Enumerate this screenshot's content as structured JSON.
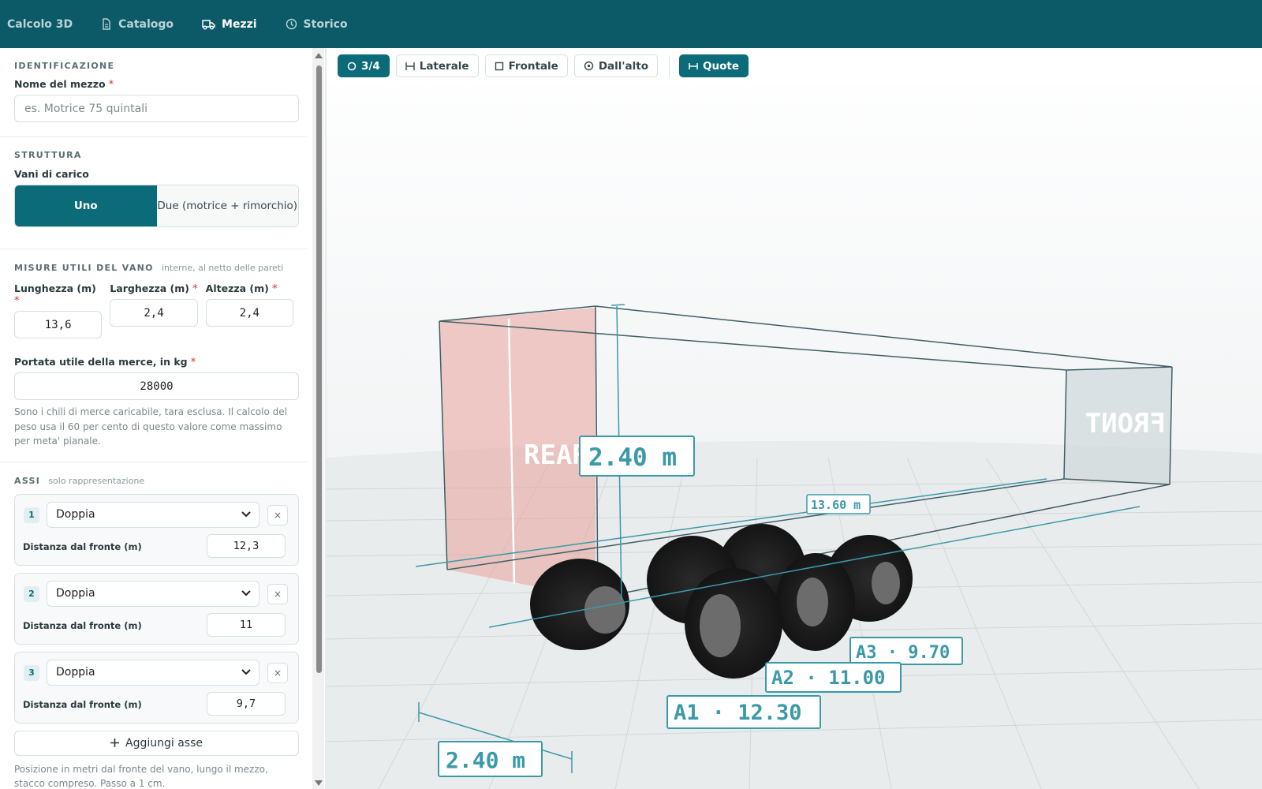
{
  "nav": {
    "items": [
      {
        "label": "Calcolo 3D",
        "icon": "none",
        "active": false
      },
      {
        "label": "Catalogo",
        "icon": "document-icon",
        "active": false
      },
      {
        "label": "Mezzi",
        "icon": "truck-icon",
        "active": true
      },
      {
        "label": "Storico",
        "icon": "clock-icon",
        "active": false
      }
    ]
  },
  "identificazione": {
    "title": "IDENTIFICAZIONE",
    "name_label": "Nome del mezzo",
    "required_mark": "*",
    "name_placeholder": "es. Motrice 75 quintali"
  },
  "struttura": {
    "title": "STRUTTURA",
    "vani_label": "Vani di carico",
    "option_one": "Uno",
    "option_two": "Due (motrice + rimorchio)",
    "selected": "Uno"
  },
  "misure": {
    "title": "MISURE UTILI DEL VANO",
    "note": "interne, al netto delle pareti",
    "length_label": "Lunghezza (m)",
    "length_value": "13,6",
    "width_label": "Larghezza (m)",
    "width_value": "2,4",
    "height_label": "Altezza (m)",
    "height_value": "2,4",
    "payload_label": "Portata utile della merce, in kg",
    "payload_value": "28000",
    "payload_help": "Sono i chili di merce caricabile, tara esclusa. Il calcolo del peso usa il 60 per cento di questo valore come massimo per meta' pianale."
  },
  "assi": {
    "title": "ASSI",
    "note": "solo rappresentazione",
    "distance_label": "Distanza dal fronte (m)",
    "items": [
      {
        "num": "1",
        "type": "Doppia",
        "distance": "12,3"
      },
      {
        "num": "2",
        "type": "Doppia",
        "distance": "11"
      },
      {
        "num": "3",
        "type": "Doppia",
        "distance": "9,7"
      }
    ],
    "remove_symbol": "×",
    "add_label": "Aggiungi asse",
    "footer_help": "Posizione in metri dal fronte del vano, lungo il mezzo, stacco compreso. Passo a 1 cm."
  },
  "viewer": {
    "views": [
      {
        "label": "3/4",
        "icon": "hexagon-icon",
        "active": true
      },
      {
        "label": "Laterale",
        "icon": "side-view-icon",
        "active": false
      },
      {
        "label": "Frontale",
        "icon": "square-icon",
        "active": false
      },
      {
        "label": "Dall'alto",
        "icon": "top-view-icon",
        "active": false
      }
    ],
    "quote_label": "Quote",
    "quote_active": true,
    "rear_text": "REAR",
    "front_text": "FRONT",
    "dim_height": "2.40 m",
    "dim_width": "2.40 m",
    "dim_length": "13.60 m",
    "axle_labels": [
      "A1 · 12.30",
      "A2 · 11.00",
      "A3 · 9.70"
    ]
  },
  "colors": {
    "brand": "#0c5a68",
    "accent": "#0c6b78",
    "dimension": "#3a9aa8",
    "rear_panel": "#e8a29a"
  }
}
